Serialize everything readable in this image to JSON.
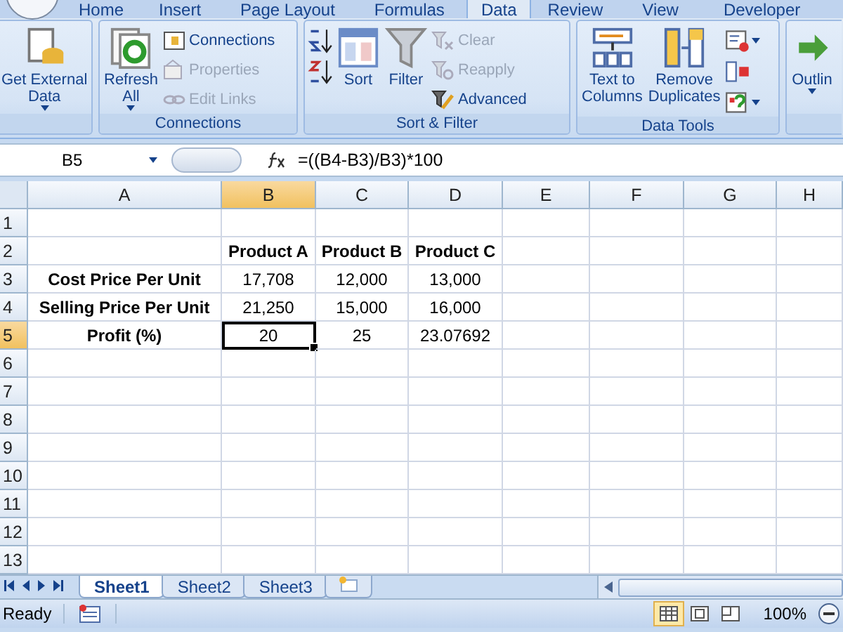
{
  "ribbon_tabs": [
    {
      "label": "Home",
      "selected": false
    },
    {
      "label": "Insert",
      "selected": false
    },
    {
      "label": "Page Layout",
      "selected": false
    },
    {
      "label": "Formulas",
      "selected": false
    },
    {
      "label": "Data",
      "selected": true
    },
    {
      "label": "Review",
      "selected": false
    },
    {
      "label": "View",
      "selected": false
    },
    {
      "label": "Developer",
      "selected": false
    }
  ],
  "ribbon_groups": [
    {
      "kind": "single",
      "buttons": [
        {
          "kind": "large",
          "label": "Get External\nData",
          "dropdown": true,
          "disabled": false
        }
      ]
    },
    {
      "kind": "normal",
      "title": "Connections",
      "buttons": [
        {
          "kind": "large",
          "label": "Refresh\nAll",
          "dropdown": true,
          "disabled": false
        },
        {
          "kind": "small",
          "label": "Connections",
          "dropdown": false,
          "disabled": false
        },
        {
          "kind": "small",
          "label": "Properties",
          "dropdown": false,
          "disabled": true
        },
        {
          "kind": "small",
          "label": "Edit Links",
          "dropdown": false,
          "disabled": true
        }
      ]
    },
    {
      "kind": "normal",
      "title": "Sort & Filter",
      "buttons": [
        {
          "kind": "tiny",
          "dropdown": false,
          "disabled": false
        },
        {
          "kind": "tiny",
          "dropdown": false,
          "disabled": false
        },
        {
          "kind": "large",
          "label": "Sort",
          "dropdown": false,
          "disabled": false
        },
        {
          "kind": "large",
          "label": "Filter",
          "dropdown": false,
          "disabled": false
        },
        {
          "kind": "small",
          "label": "Clear",
          "dropdown": false,
          "disabled": true
        },
        {
          "kind": "small",
          "label": "Reapply",
          "dropdown": false,
          "disabled": true
        },
        {
          "kind": "small",
          "label": "Advanced",
          "dropdown": false,
          "disabled": false
        }
      ]
    },
    {
      "kind": "normal",
      "title": "Data Tools",
      "buttons": [
        {
          "kind": "large",
          "label": "Text to\nColumns",
          "dropdown": false,
          "disabled": false
        },
        {
          "kind": "large",
          "label": "Remove\nDuplicates",
          "dropdown": false,
          "disabled": false
        },
        {
          "kind": "tiny",
          "dropdown": true,
          "disabled": false
        },
        {
          "kind": "tiny",
          "dropdown": false,
          "disabled": false
        },
        {
          "kind": "tiny",
          "dropdown": true,
          "disabled": false
        }
      ]
    },
    {
      "kind": "cut",
      "buttons": [
        {
          "kind": "large",
          "label": "Outlin",
          "dropdown": true,
          "disabled": false
        }
      ]
    }
  ],
  "formula_bar": {
    "name_box": "B5",
    "formula": "=((B4-B3)/B3)*100"
  },
  "columns": [
    {
      "label": "A",
      "selected": false
    },
    {
      "label": "B",
      "selected": true
    },
    {
      "label": "C",
      "selected": false
    },
    {
      "label": "D",
      "selected": false
    },
    {
      "label": "E",
      "selected": false
    },
    {
      "label": "F",
      "selected": false
    },
    {
      "label": "G",
      "selected": false
    },
    {
      "label": "H",
      "selected": false
    }
  ],
  "rows": [
    {
      "label": "1",
      "selected": false,
      "cells": [
        null,
        null,
        null,
        null,
        null,
        null,
        null,
        null
      ]
    },
    {
      "label": "2",
      "selected": false,
      "cells": [
        null,
        {
          "text": "Product A",
          "bold": true,
          "selected": false
        },
        {
          "text": "Product B",
          "bold": true,
          "selected": false
        },
        {
          "text": "Product C",
          "bold": true,
          "selected": false
        },
        null,
        null,
        null,
        null
      ]
    },
    {
      "label": "3",
      "selected": false,
      "cells": [
        {
          "text": "Cost Price Per Unit",
          "bold": true,
          "selected": false
        },
        {
          "text": "17,708",
          "bold": false,
          "selected": false
        },
        {
          "text": "12,000",
          "bold": false,
          "selected": false
        },
        {
          "text": "13,000",
          "bold": false,
          "selected": false
        },
        null,
        null,
        null,
        null
      ]
    },
    {
      "label": "4",
      "selected": false,
      "cells": [
        {
          "text": "Selling Price Per Unit",
          "bold": true,
          "selected": false
        },
        {
          "text": "21,250",
          "bold": false,
          "selected": false
        },
        {
          "text": "15,000",
          "bold": false,
          "selected": false
        },
        {
          "text": "16,000",
          "bold": false,
          "selected": false
        },
        null,
        null,
        null,
        null
      ]
    },
    {
      "label": "5",
      "selected": true,
      "cells": [
        {
          "text": "Profit (%)",
          "bold": true,
          "selected": false
        },
        {
          "text": "20",
          "bold": false,
          "selected": true
        },
        {
          "text": "25",
          "bold": false,
          "selected": false
        },
        {
          "text": "23.07692",
          "bold": false,
          "selected": false
        },
        null,
        null,
        null,
        null
      ]
    },
    {
      "label": "6",
      "selected": false,
      "cells": [
        null,
        null,
        null,
        null,
        null,
        null,
        null,
        null
      ]
    },
    {
      "label": "7",
      "selected": false,
      "cells": [
        null,
        null,
        null,
        null,
        null,
        null,
        null,
        null
      ]
    },
    {
      "label": "8",
      "selected": false,
      "cells": [
        null,
        null,
        null,
        null,
        null,
        null,
        null,
        null
      ]
    },
    {
      "label": "9",
      "selected": false,
      "cells": [
        null,
        null,
        null,
        null,
        null,
        null,
        null,
        null
      ]
    },
    {
      "label": "10",
      "selected": false,
      "cells": [
        null,
        null,
        null,
        null,
        null,
        null,
        null,
        null
      ]
    },
    {
      "label": "11",
      "selected": false,
      "cells": [
        null,
        null,
        null,
        null,
        null,
        null,
        null,
        null
      ]
    },
    {
      "label": "12",
      "selected": false,
      "cells": [
        null,
        null,
        null,
        null,
        null,
        null,
        null,
        null
      ]
    },
    {
      "label": "13",
      "selected": false,
      "cells": [
        null,
        null,
        null,
        null,
        null,
        null,
        null,
        null
      ]
    }
  ],
  "sheet_tabs": [
    {
      "label": "Sheet1",
      "selected": true
    },
    {
      "label": "Sheet2",
      "selected": false
    },
    {
      "label": "Sheet3",
      "selected": false
    }
  ],
  "status_bar": {
    "status": "Ready",
    "zoom": "100%",
    "views": [
      {
        "selected": true
      },
      {
        "selected": false
      },
      {
        "selected": false
      }
    ]
  }
}
